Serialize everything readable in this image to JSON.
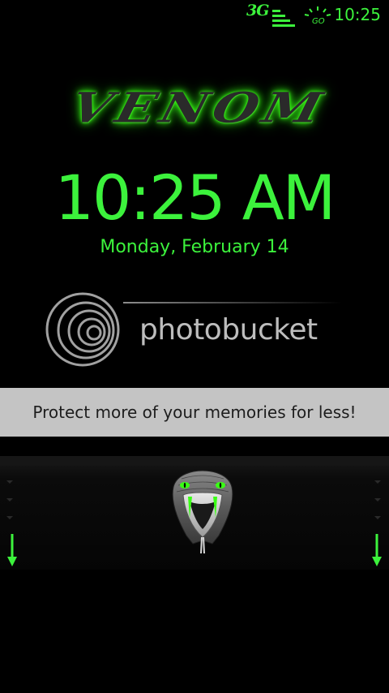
{
  "status_bar": {
    "network": "3G",
    "battery_label": "GO",
    "time": "10:25"
  },
  "logo": {
    "text": "VENOM"
  },
  "lockscreen": {
    "time": "10:25 AM",
    "date": "Monday, February 14"
  },
  "watermark": {
    "text": "photobucket"
  },
  "banner": {
    "text": "Protect more of your memories for less!"
  },
  "colors": {
    "accent": "#3cf23c",
    "background": "#000000",
    "banner_bg": "#c4c4c4",
    "banner_text": "#1d1d1d"
  },
  "icons": {
    "signal": "signal-bars-icon",
    "battery": "battery-icon",
    "handle": "snake-head-icon",
    "unlock_left": "arrow-down-icon",
    "unlock_right": "arrow-down-icon"
  }
}
